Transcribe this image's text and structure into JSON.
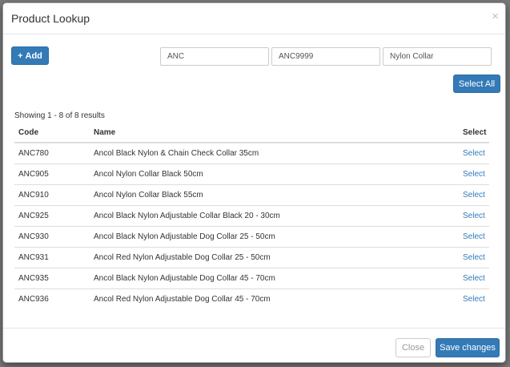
{
  "modal": {
    "title": "Product Lookup",
    "close_glyph": "×"
  },
  "toolbar": {
    "add_label": "Add",
    "plus_glyph": "+",
    "select_all_label": "Select All"
  },
  "filters": {
    "filter1_value": "ANC",
    "filter2_value": "ANC9999",
    "filter3_value": "Nylon Collar"
  },
  "results": {
    "showing_text": "Showing 1 - 8 of 8 results",
    "headers": {
      "code": "Code",
      "name": "Name",
      "select": "Select"
    },
    "rows": [
      {
        "code": "ANC780",
        "name": "Ancol Black Nylon & Chain Check Collar 35cm",
        "select": "Select"
      },
      {
        "code": "ANC905",
        "name": "Ancol Nylon Collar Black 50cm",
        "select": "Select"
      },
      {
        "code": "ANC910",
        "name": "Ancol Nylon Collar Black 55cm",
        "select": "Select"
      },
      {
        "code": "ANC925",
        "name": "Ancol Black Nylon Adjustable Collar Black 20 - 30cm",
        "select": "Select"
      },
      {
        "code": "ANC930",
        "name": "Ancol Black Nylon Adjustable Dog Collar 25 - 50cm",
        "select": "Select"
      },
      {
        "code": "ANC931",
        "name": "Ancol Red Nylon Adjustable Dog Collar 25 - 50cm",
        "select": "Select"
      },
      {
        "code": "ANC935",
        "name": "Ancol Black Nylon Adjustable Dog Collar 45 - 70cm",
        "select": "Select"
      },
      {
        "code": "ANC936",
        "name": "Ancol Red Nylon Adjustable Dog Collar 45 - 70cm",
        "select": "Select"
      }
    ]
  },
  "footer": {
    "close_label": "Close",
    "save_label": "Save changes"
  },
  "colors": {
    "primary": "#337ab7",
    "backdrop": "#7a7a7a"
  }
}
